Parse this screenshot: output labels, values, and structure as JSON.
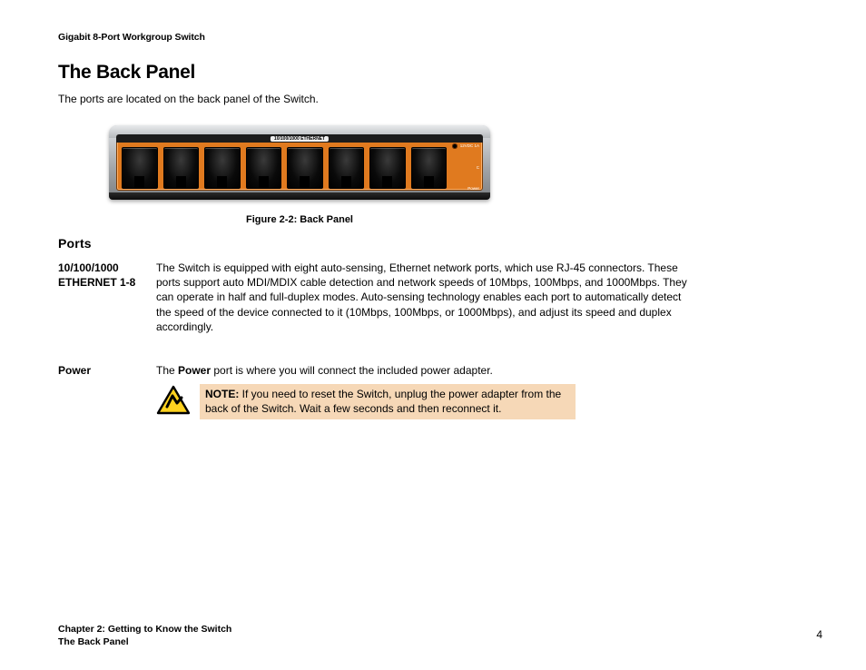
{
  "header": "Gigabit 8-Port Workgroup Switch",
  "title": "The Back Panel",
  "intro": "The ports are located on the back panel of the Switch.",
  "figure": {
    "band_label": "10/100/1000 ETHERNET",
    "right": {
      "voltage": "12VDC 1A",
      "c": "C",
      "power": "Power"
    },
    "caption": "Figure 2-2: Back Panel"
  },
  "ports_heading": "Ports",
  "ethernet": {
    "label_line1": "10/100/1000",
    "label_line2": "ETHERNET 1-8",
    "text": "The Switch is equipped with eight auto-sensing, Ethernet network ports, which use RJ-45 connectors. These ports support auto MDI/MDIX cable detection and network speeds of 10Mbps, 100Mbps, and 1000Mbps. They can operate in half and full-duplex modes. Auto-sensing technology enables each port to automatically detect the speed of the device connected to it (10Mbps, 100Mbps, or 1000Mbps), and adjust its speed and duplex accordingly."
  },
  "power": {
    "label": "Power",
    "pre": "The ",
    "bold": "Power",
    "post": " port is where you will connect the included power adapter."
  },
  "note": {
    "lead": "NOTE: ",
    "text": "If you need to reset the Switch, unplug the power adapter from the back of the Switch. Wait a few seconds and then reconnect it."
  },
  "footer": {
    "line1": "Chapter 2: Getting to Know the Switch",
    "line2": "The Back Panel"
  },
  "page_number": "4"
}
